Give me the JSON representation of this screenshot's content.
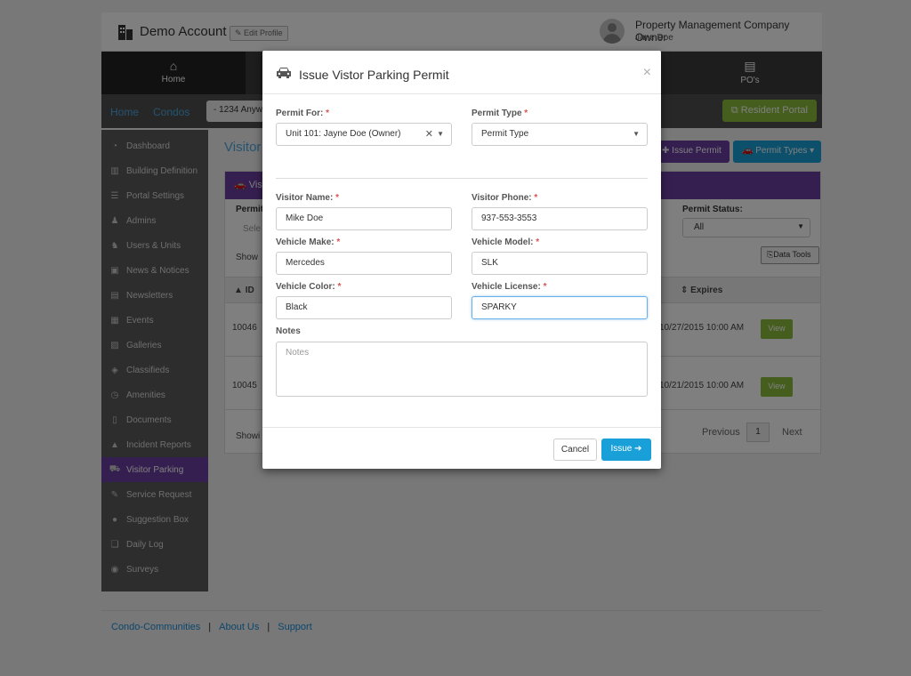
{
  "account": {
    "name": "Demo Account",
    "edit_profile": "Edit Profile"
  },
  "user": {
    "role": "Property Management Company Owner",
    "name": "Jane Doe"
  },
  "nav": {
    "home": "Home",
    "pos": "PO's"
  },
  "breadcrumb": {
    "home": "Home",
    "condos": "Condos",
    "address": "- 1234 Anyw"
  },
  "resident_portal": "Resident Portal",
  "sidebar": {
    "items": [
      {
        "label": "Dashboard",
        "icon": "dashboard-icon"
      },
      {
        "label": "Building Definition",
        "icon": "building-icon"
      },
      {
        "label": "Portal Settings",
        "icon": "sliders-icon"
      },
      {
        "label": "Admins",
        "icon": "admin-icon"
      },
      {
        "label": "Users & Units",
        "icon": "users-icon"
      },
      {
        "label": "News & Notices",
        "icon": "newspaper-icon"
      },
      {
        "label": "Newsletters",
        "icon": "document-icon"
      },
      {
        "label": "Events",
        "icon": "calendar-icon"
      },
      {
        "label": "Galleries",
        "icon": "image-icon"
      },
      {
        "label": "Classifieds",
        "icon": "tag-icon"
      },
      {
        "label": "Amenities",
        "icon": "clock-icon"
      },
      {
        "label": "Documents",
        "icon": "file-icon"
      },
      {
        "label": "Incident Reports",
        "icon": "warning-icon"
      },
      {
        "label": "Visitor Parking",
        "icon": "car-icon",
        "active": true
      },
      {
        "label": "Service Request",
        "icon": "wrench-icon"
      },
      {
        "label": "Suggestion Box",
        "icon": "comment-icon"
      },
      {
        "label": "Daily Log",
        "icon": "book-icon"
      },
      {
        "label": "Surveys",
        "icon": "chat-icon"
      }
    ]
  },
  "main": {
    "title": "Visitor",
    "issue_permit": "Issue Permit",
    "permit_types": "Permit Types",
    "panel_title": "Vis",
    "permit_label": "Permit",
    "select_placeholder": "Sele",
    "show_label": "Show",
    "permit_status_label": "Permit Status:",
    "permit_status_value": "All",
    "data_tools": "Data Tools",
    "columns": {
      "id": "ID",
      "expires": "Expires"
    },
    "rows": [
      {
        "id": "10046",
        "expires": "10/27/2015 10:00 AM",
        "action": "View"
      },
      {
        "id": "10045",
        "expires": "10/21/2015 10:00 AM",
        "action": "View"
      }
    ],
    "showing": "Showi",
    "previous": "Previous",
    "page": "1",
    "next": "Next"
  },
  "footer": {
    "links": [
      "Condo-Communities",
      "About Us",
      "Support"
    ]
  },
  "modal": {
    "title": "Issue Vistor Parking Permit",
    "close": "×",
    "permit_for": {
      "label": "Permit For:",
      "value": "Unit 101: Jayne Doe (Owner)"
    },
    "permit_type": {
      "label": "Permit Type",
      "value": "Permit Type"
    },
    "visitor_name": {
      "label": "Visitor Name:",
      "value": "Mike Doe"
    },
    "visitor_phone": {
      "label": "Visitor Phone:",
      "value": "937-553-3553"
    },
    "vehicle_make": {
      "label": "Vehicle Make:",
      "value": "Mercedes"
    },
    "vehicle_model": {
      "label": "Vehicle Model:",
      "value": "SLK"
    },
    "vehicle_color": {
      "label": "Vehicle Color:",
      "value": "Black"
    },
    "vehicle_license": {
      "label": "Vehicle License:",
      "value": "SPARKY"
    },
    "notes": {
      "label": "Notes",
      "placeholder": "Notes"
    },
    "required_mark": "*",
    "cancel": "Cancel",
    "issue": "Issue"
  },
  "colors": {
    "purple": "#6b3fa0",
    "blue": "#1aa0d8",
    "green": "#8bbd3a",
    "required": "#d9534f"
  }
}
